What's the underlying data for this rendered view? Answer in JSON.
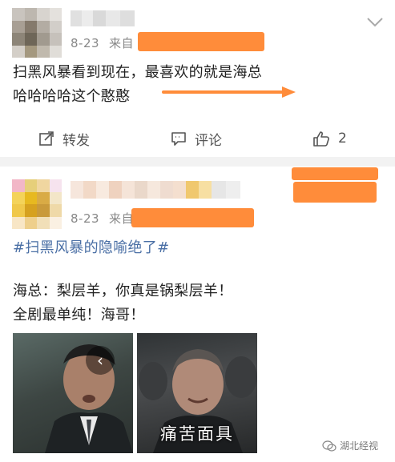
{
  "post1": {
    "date": "8-23",
    "from_label": "来自",
    "text_line1": "扫黑风暴看到现在，最喜欢的就是海总",
    "text_line2": "哈哈哈哈这个憨憨",
    "actions": {
      "repost_label": "转发",
      "comment_label": "评论",
      "like_count": "2"
    }
  },
  "post2": {
    "date": "8-23",
    "from_label": "来自",
    "hashtag": "#扫黑风暴的隐喻绝了#",
    "body_line1": "海总：梨层羊，你真是锅梨层羊！",
    "body_line2": "全剧最单纯！海哥！",
    "image2_caption": "痛苦面具",
    "nav_arrow": "‹"
  },
  "watermark": {
    "text": "湖北经视"
  },
  "colors": {
    "accent_orange": "#ff8c3a",
    "hashtag_blue": "#4a6fa5",
    "meta_gray": "#888888"
  }
}
